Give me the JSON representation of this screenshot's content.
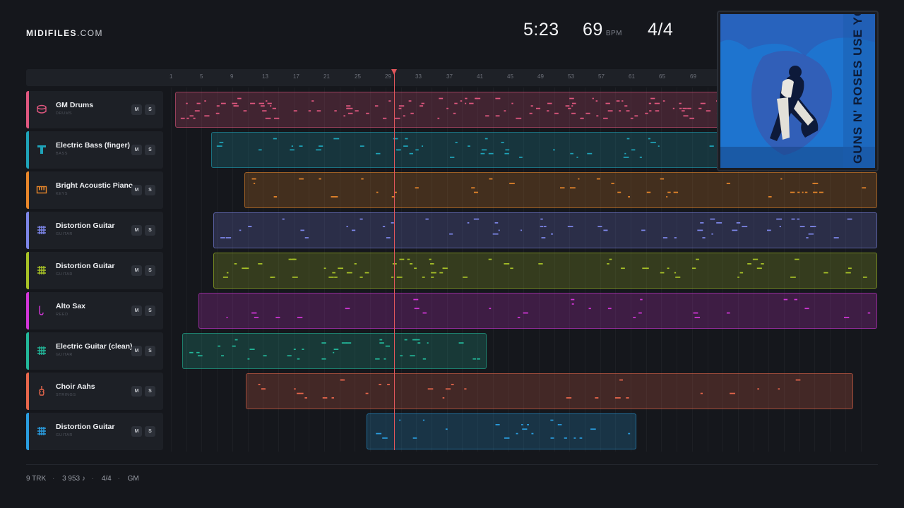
{
  "brand": {
    "bold": "MIDIFILES",
    "light": ".COM"
  },
  "header": {
    "duration": "5:23",
    "tempo": "69",
    "tempo_unit": "BPM",
    "time_signature": "4/4"
  },
  "ruler": {
    "ticks": [
      "1",
      "5",
      "9",
      "13",
      "17",
      "21",
      "25",
      "29",
      "33",
      "37",
      "41",
      "45",
      "49",
      "53",
      "57",
      "61",
      "65",
      "69"
    ]
  },
  "tracks": [
    {
      "name": "GM Drums",
      "category": "DRUMS",
      "color": "#e0577f",
      "icon": "drum-icon"
    },
    {
      "name": "Electric Bass (finger)",
      "category": "BASS",
      "color": "#1fa3b8",
      "icon": "bass-icon"
    },
    {
      "name": "Bright Acoustic Piano",
      "category": "KEYS",
      "color": "#e8872b",
      "icon": "piano-icon"
    },
    {
      "name": "Distortion Guitar",
      "category": "GUITAR",
      "color": "#7d86e8",
      "icon": "guitar-fretboard-icon"
    },
    {
      "name": "Distortion Guitar",
      "category": "GUITAR",
      "color": "#a8c227",
      "icon": "guitar-fretboard-icon"
    },
    {
      "name": "Alto Sax",
      "category": "REED",
      "color": "#d236d8",
      "icon": "sax-icon"
    },
    {
      "name": "Electric Guitar (clean)",
      "category": "GUITAR",
      "color": "#23b89a",
      "icon": "guitar-fretboard-icon"
    },
    {
      "name": "Choir Aahs",
      "category": "STRINGS",
      "color": "#e8674c",
      "icon": "violin-icon"
    },
    {
      "name": "Distortion Guitar",
      "category": "GUITAR",
      "color": "#2a9ee0",
      "icon": "guitar-fretboard-icon"
    }
  ],
  "buttons": {
    "mute": "M",
    "solo": "S"
  },
  "cover": {
    "text": "GUNS N' ROSES USE YOUR ILLUSION II"
  },
  "footer": {
    "tracks": "9 TRK",
    "notes": "3 953 ♪",
    "time_signature": "4/4",
    "standard": "GM",
    "separator": "·"
  }
}
